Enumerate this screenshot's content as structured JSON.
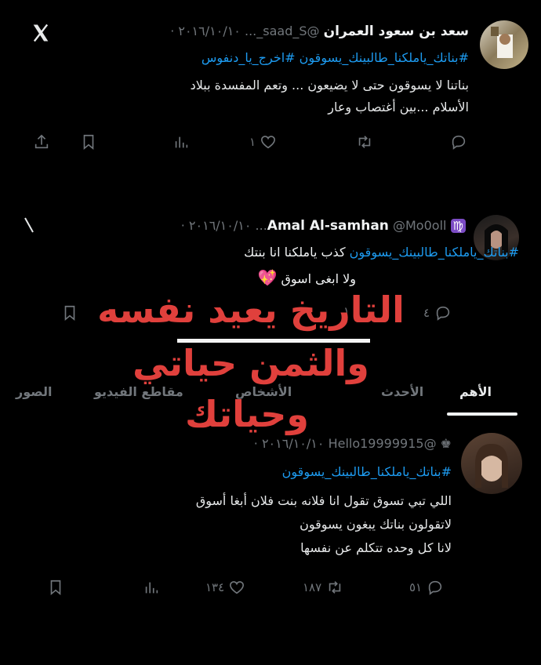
{
  "tweet1": {
    "name": "سعد بن سعود العمران",
    "handle": "@saad_S_...",
    "date": "٢٠١٦/١٠/١٠ ·",
    "hashtags": "#بناتك_ياملكنا_طالبينك_يسوقون #اخرج_يا_دنفوس",
    "line1": "بناتنا لا يسوقون حتى لا يضيعون ... وتعم المفسدة ببلاد",
    "line2": "الأسلام ...بين أغتصاب وعار",
    "likes": "١",
    "icons": {
      "close": "x-logo-icon",
      "share": "share-icon",
      "bookmark": "bookmark-icon",
      "views": "views-icon",
      "like": "heart-icon",
      "retweet": "retweet-icon",
      "reply": "reply-icon"
    }
  },
  "tweet2": {
    "name": "Amal Al-samhan",
    "badge": "♍",
    "handle": "@Mo0oll...",
    "date": "٢٠١٦/١٠/١٠ ·",
    "line1_hashtag": "#بناتك_ياملكنا_طالبينك_يسوقون",
    "line1_text": "كذب ياملكنا انا بنتك",
    "line2": "ولا ابغى اسوق",
    "emoji": "💖",
    "reply_count": "٤",
    "partial_count": "١"
  },
  "overlay": {
    "line1": "التاريخ يعيد نفسه",
    "line2": "والثمن حياتي",
    "line3": "وحياتك",
    "color": "#e0403c"
  },
  "tabs": {
    "t1": "الأهم",
    "t2": "الأحدث",
    "t3": "الأشخاص",
    "t4": "مقاطع الفيديو",
    "t5": "الصور"
  },
  "tweet3": {
    "name": "",
    "handle": "@Hello19999915",
    "date": "٢٠١٦/١٠/١٠ ·",
    "hashtag": "#بناتك_ياملكنا_طالبينك_يسوقون",
    "line1": "اللي تبي تسوق تقول انا فلانه بنت فلان أبغا أسوق",
    "line2": "لاتقولون بناتك يبغون يسوقون",
    "line3": "لانا كل وحده تتكلم عن نفسها",
    "likes": "١٣٤",
    "retweets": "١٨٧",
    "replies": "٥١"
  }
}
